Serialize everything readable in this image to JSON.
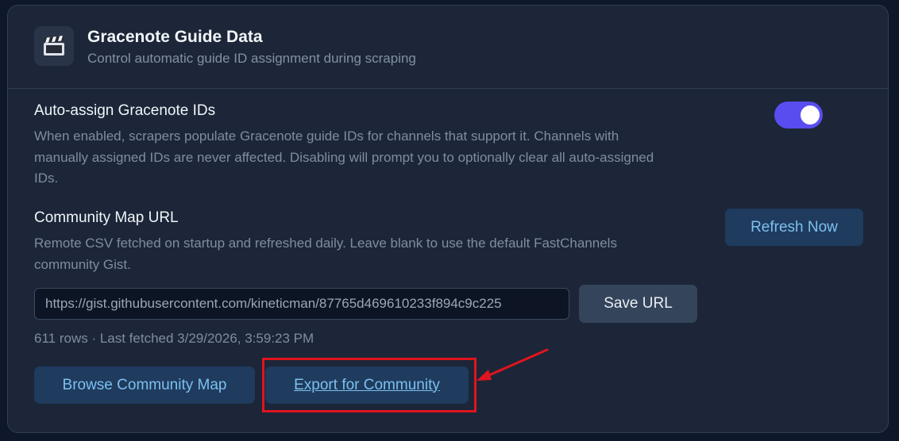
{
  "header": {
    "icon": "clapper-board-icon",
    "title": "Gracenote Guide Data",
    "subtitle": "Control automatic guide ID assignment during scraping"
  },
  "auto_assign": {
    "title": "Auto-assign Gracenote IDs",
    "description_lines": [
      "When enabled, scrapers populate Gracenote guide IDs for channels that support it. Channels with",
      "manually assigned IDs are never affected. Disabling will prompt you to optionally clear all auto-assigned",
      "IDs."
    ],
    "toggle_on": true
  },
  "community_map": {
    "title": "Community Map URL",
    "description_lines": [
      "Remote CSV fetched on startup and refreshed daily. Leave blank to use the default FastChannels",
      "community Gist."
    ],
    "refresh_label": "Refresh Now",
    "url_value": "https://gist.githubusercontent.com/kineticman/87765d469610233f894c9c225",
    "save_label": "Save URL",
    "meta": "611 rows · Last fetched 3/29/2026, 3:59:23 PM",
    "browse_label": "Browse Community Map",
    "export_label": "Export for Community"
  },
  "colors": {
    "card_bg": "#1c2638",
    "accent_toggle": "#5a4df0",
    "button_blue_bg": "#1f3b5e",
    "button_blue_text": "#7cc0ee",
    "annotation_red": "#e0141e"
  }
}
